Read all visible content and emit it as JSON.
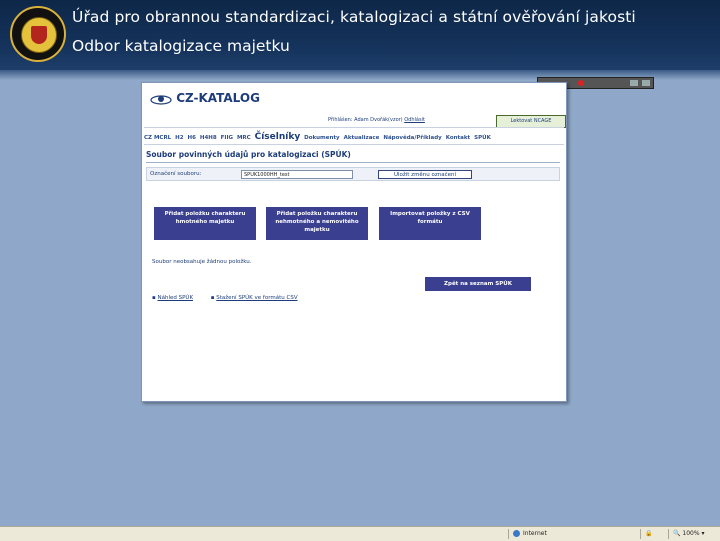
{
  "slide": {
    "title": "Úřad pro obrannou standardizaci, katalogizaci a státní ověřování jakosti",
    "subtitle": "Odbor katalogizace majetku"
  },
  "app": {
    "logo_text": "CZ-KATALOG",
    "user_info": "Přihlášen: Adam Dvořák(vzor)",
    "user_link": "Odhlásit",
    "logout_button": "Lektovat NCAGE",
    "menu": [
      "CZ MCRL",
      "H2",
      "H6",
      "H4H8",
      "FIIG",
      "MRC",
      "Číselníky",
      "Dokumenty",
      "Aktualizace",
      "Nápověda/Příklady",
      "Kontakt",
      "SPÚK"
    ],
    "menu_highlight": "Číselníky",
    "heading": "Soubor povinných údajů pro katalogizaci (SPÚK)",
    "form": {
      "label": "Označení souboru:",
      "value": "SPUK1000HH_test",
      "button": "Uložit změnu označení"
    },
    "actions": [
      "Přidat položku charakteru hmotného majetku",
      "Přidat položku charakteru nehmotného a nemovitého majetku",
      "Importovat položky z CSV formátu"
    ],
    "empty_message": "Soubor neobsahuje žádnou položku.",
    "back_button": "Zpět na seznam SPÚK",
    "links": [
      "Náhled SPÚK",
      "Stažení SPÚK ve formátu CSV"
    ]
  },
  "statusbar": {
    "zone": "Internet",
    "zoom": "100%"
  },
  "colors": {
    "header_bg": "#0e2748",
    "page_bg": "#8fa8c9",
    "button_bg": "#3a3f8f",
    "text_link": "#1d3c7a"
  }
}
